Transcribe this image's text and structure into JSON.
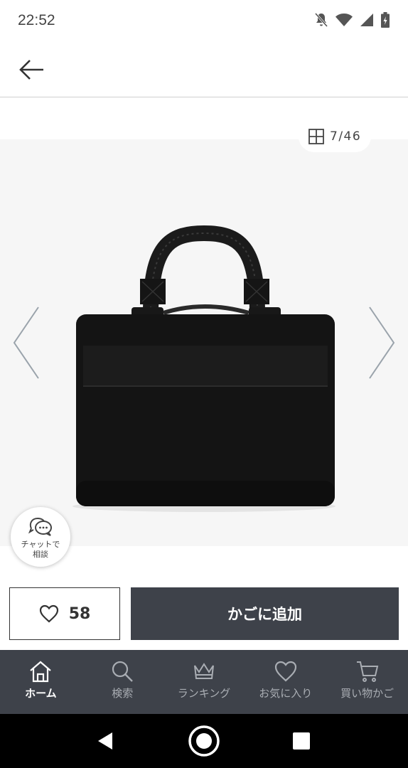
{
  "status_bar": {
    "time": "22:52"
  },
  "gallery": {
    "counter": "7/46",
    "product_image_alt": "黒いビジネスバッグ"
  },
  "chat_bubble": {
    "line1": "チャットで",
    "line2": "相談"
  },
  "favorite": {
    "count": "58"
  },
  "add_to_cart": {
    "label": "かごに追加"
  },
  "tabs": [
    {
      "label": "ホーム",
      "icon": "home-icon",
      "active": true
    },
    {
      "label": "検索",
      "icon": "search-icon",
      "active": false
    },
    {
      "label": "ランキング",
      "icon": "crown-icon",
      "active": false
    },
    {
      "label": "お気に入り",
      "icon": "heart-icon",
      "active": false
    },
    {
      "label": "買い物かご",
      "icon": "cart-icon",
      "active": false
    }
  ],
  "colors": {
    "dark_accent": "#3e424a",
    "gallery_bg": "#f6f6f6",
    "inactive_tab": "#a9adb3"
  }
}
